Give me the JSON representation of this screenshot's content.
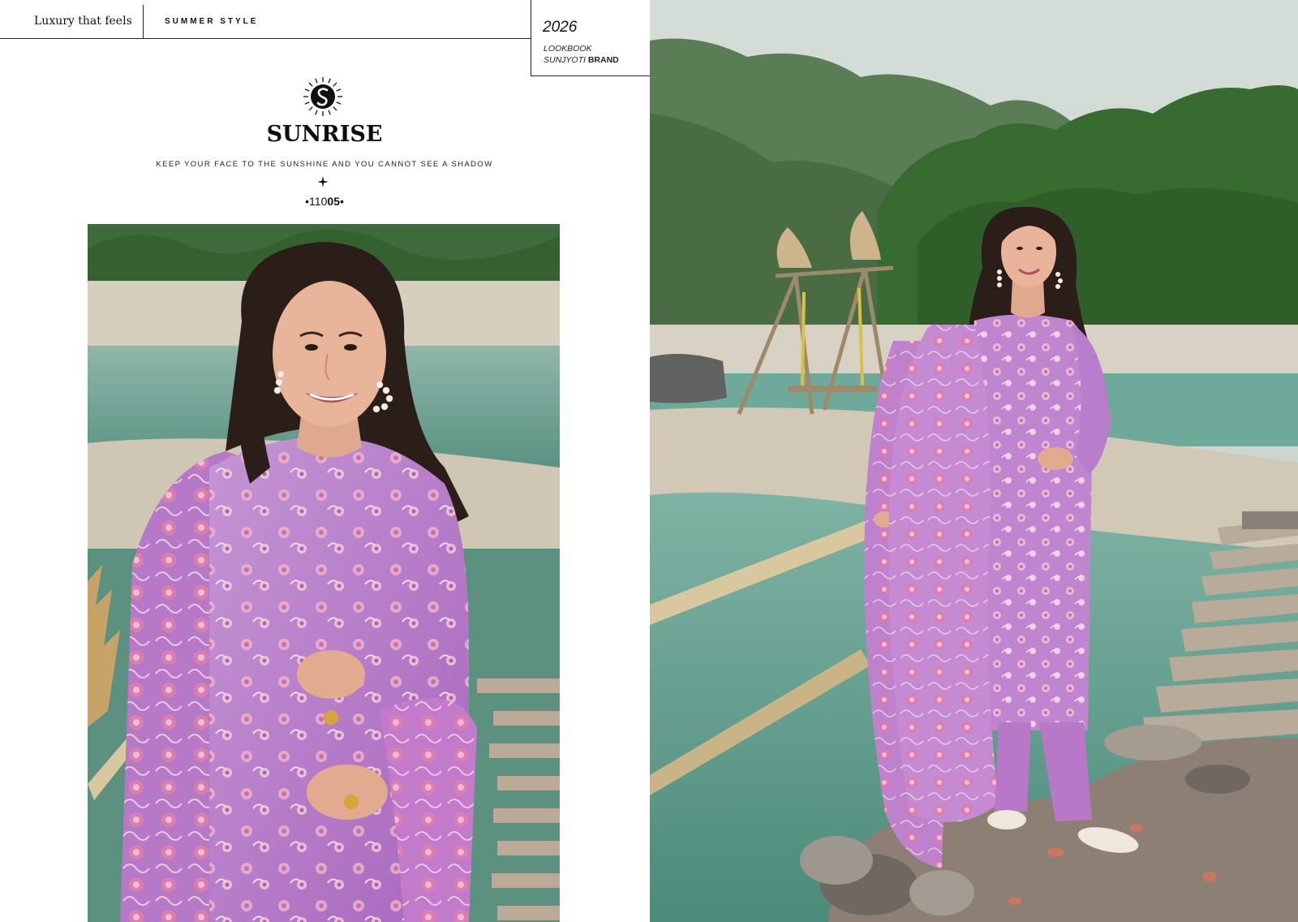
{
  "header": {
    "tagline": "Luxury that feels",
    "collection": "SUMMER STYLE"
  },
  "lookbook": {
    "year": "2026",
    "label": "LOOKBOOK",
    "brand_name": "SUNJYOTI",
    "brand_word": "BRAND"
  },
  "brand": {
    "name": "SUNRISE",
    "slogan": "KEEP YOUR FACE TO THE SUNSHINE AND YOU CANNOT SEE A SHADOW",
    "design_prefix": "•110",
    "design_suffix": "05",
    "design_end": "•"
  },
  "colors": {
    "outfit": "#b77bc8",
    "dupatta_print": "#d76a99",
    "river": "#5f9c8a",
    "foliage": "#3f6d3a",
    "sand": "#d9d2c4"
  },
  "icons": [
    "sunrise-logo-icon",
    "sparkle-icon"
  ]
}
